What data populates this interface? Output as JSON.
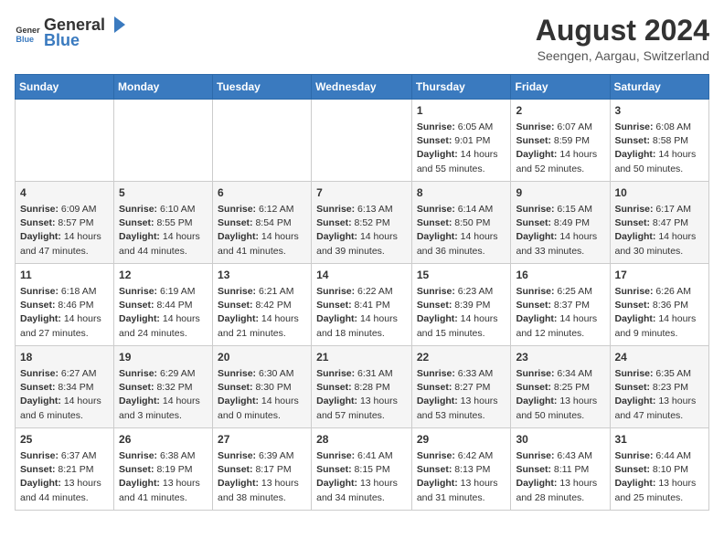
{
  "header": {
    "logo_general": "General",
    "logo_blue": "Blue",
    "title": "August 2024",
    "subtitle": "Seengen, Aargau, Switzerland"
  },
  "days_of_week": [
    "Sunday",
    "Monday",
    "Tuesday",
    "Wednesday",
    "Thursday",
    "Friday",
    "Saturday"
  ],
  "weeks": [
    [
      {
        "day": "",
        "content": ""
      },
      {
        "day": "",
        "content": ""
      },
      {
        "day": "",
        "content": ""
      },
      {
        "day": "",
        "content": ""
      },
      {
        "day": "1",
        "content": "Sunrise: 6:05 AM\nSunset: 9:01 PM\nDaylight: 14 hours and 55 minutes."
      },
      {
        "day": "2",
        "content": "Sunrise: 6:07 AM\nSunset: 8:59 PM\nDaylight: 14 hours and 52 minutes."
      },
      {
        "day": "3",
        "content": "Sunrise: 6:08 AM\nSunset: 8:58 PM\nDaylight: 14 hours and 50 minutes."
      }
    ],
    [
      {
        "day": "4",
        "content": "Sunrise: 6:09 AM\nSunset: 8:57 PM\nDaylight: 14 hours and 47 minutes."
      },
      {
        "day": "5",
        "content": "Sunrise: 6:10 AM\nSunset: 8:55 PM\nDaylight: 14 hours and 44 minutes."
      },
      {
        "day": "6",
        "content": "Sunrise: 6:12 AM\nSunset: 8:54 PM\nDaylight: 14 hours and 41 minutes."
      },
      {
        "day": "7",
        "content": "Sunrise: 6:13 AM\nSunset: 8:52 PM\nDaylight: 14 hours and 39 minutes."
      },
      {
        "day": "8",
        "content": "Sunrise: 6:14 AM\nSunset: 8:50 PM\nDaylight: 14 hours and 36 minutes."
      },
      {
        "day": "9",
        "content": "Sunrise: 6:15 AM\nSunset: 8:49 PM\nDaylight: 14 hours and 33 minutes."
      },
      {
        "day": "10",
        "content": "Sunrise: 6:17 AM\nSunset: 8:47 PM\nDaylight: 14 hours and 30 minutes."
      }
    ],
    [
      {
        "day": "11",
        "content": "Sunrise: 6:18 AM\nSunset: 8:46 PM\nDaylight: 14 hours and 27 minutes."
      },
      {
        "day": "12",
        "content": "Sunrise: 6:19 AM\nSunset: 8:44 PM\nDaylight: 14 hours and 24 minutes."
      },
      {
        "day": "13",
        "content": "Sunrise: 6:21 AM\nSunset: 8:42 PM\nDaylight: 14 hours and 21 minutes."
      },
      {
        "day": "14",
        "content": "Sunrise: 6:22 AM\nSunset: 8:41 PM\nDaylight: 14 hours and 18 minutes."
      },
      {
        "day": "15",
        "content": "Sunrise: 6:23 AM\nSunset: 8:39 PM\nDaylight: 14 hours and 15 minutes."
      },
      {
        "day": "16",
        "content": "Sunrise: 6:25 AM\nSunset: 8:37 PM\nDaylight: 14 hours and 12 minutes."
      },
      {
        "day": "17",
        "content": "Sunrise: 6:26 AM\nSunset: 8:36 PM\nDaylight: 14 hours and 9 minutes."
      }
    ],
    [
      {
        "day": "18",
        "content": "Sunrise: 6:27 AM\nSunset: 8:34 PM\nDaylight: 14 hours and 6 minutes."
      },
      {
        "day": "19",
        "content": "Sunrise: 6:29 AM\nSunset: 8:32 PM\nDaylight: 14 hours and 3 minutes."
      },
      {
        "day": "20",
        "content": "Sunrise: 6:30 AM\nSunset: 8:30 PM\nDaylight: 14 hours and 0 minutes."
      },
      {
        "day": "21",
        "content": "Sunrise: 6:31 AM\nSunset: 8:28 PM\nDaylight: 13 hours and 57 minutes."
      },
      {
        "day": "22",
        "content": "Sunrise: 6:33 AM\nSunset: 8:27 PM\nDaylight: 13 hours and 53 minutes."
      },
      {
        "day": "23",
        "content": "Sunrise: 6:34 AM\nSunset: 8:25 PM\nDaylight: 13 hours and 50 minutes."
      },
      {
        "day": "24",
        "content": "Sunrise: 6:35 AM\nSunset: 8:23 PM\nDaylight: 13 hours and 47 minutes."
      }
    ],
    [
      {
        "day": "25",
        "content": "Sunrise: 6:37 AM\nSunset: 8:21 PM\nDaylight: 13 hours and 44 minutes."
      },
      {
        "day": "26",
        "content": "Sunrise: 6:38 AM\nSunset: 8:19 PM\nDaylight: 13 hours and 41 minutes."
      },
      {
        "day": "27",
        "content": "Sunrise: 6:39 AM\nSunset: 8:17 PM\nDaylight: 13 hours and 38 minutes."
      },
      {
        "day": "28",
        "content": "Sunrise: 6:41 AM\nSunset: 8:15 PM\nDaylight: 13 hours and 34 minutes."
      },
      {
        "day": "29",
        "content": "Sunrise: 6:42 AM\nSunset: 8:13 PM\nDaylight: 13 hours and 31 minutes."
      },
      {
        "day": "30",
        "content": "Sunrise: 6:43 AM\nSunset: 8:11 PM\nDaylight: 13 hours and 28 minutes."
      },
      {
        "day": "31",
        "content": "Sunrise: 6:44 AM\nSunset: 8:10 PM\nDaylight: 13 hours and 25 minutes."
      }
    ]
  ]
}
